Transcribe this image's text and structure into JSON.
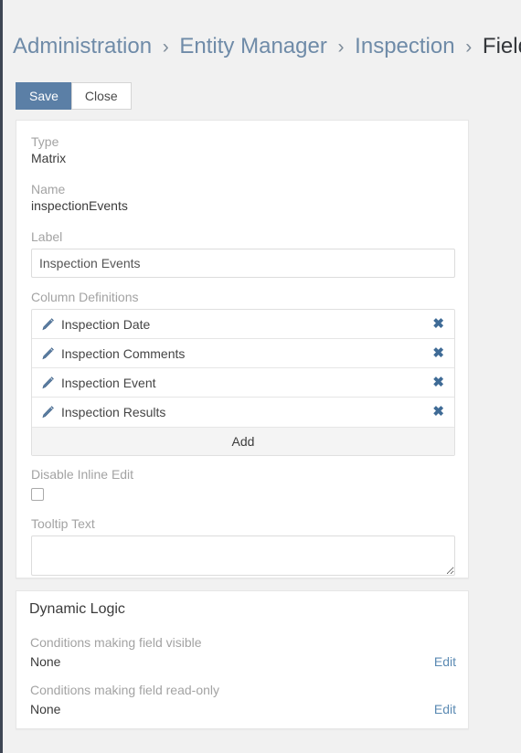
{
  "breadcrumb": {
    "separator": "›",
    "items": [
      {
        "label": "Administration",
        "current": false
      },
      {
        "label": "Entity Manager",
        "current": false
      },
      {
        "label": "Inspection",
        "current": false
      },
      {
        "label": "Fields",
        "current": true
      }
    ]
  },
  "toolbar": {
    "save_label": "Save",
    "close_label": "Close"
  },
  "field_panel": {
    "type": {
      "label": "Type",
      "value": "Matrix"
    },
    "name": {
      "label": "Name",
      "value": "inspectionEvents"
    },
    "label_field": {
      "label": "Label",
      "value": "Inspection Events",
      "placeholder": ""
    },
    "column_definitions": {
      "label": "Column Definitions",
      "add_label": "Add",
      "remove_icon": "✖",
      "items": [
        {
          "name": "Inspection Date"
        },
        {
          "name": "Inspection Comments"
        },
        {
          "name": "Inspection Event"
        },
        {
          "name": "Inspection Results"
        }
      ]
    },
    "disable_inline_edit": {
      "label": "Disable Inline Edit",
      "checked": false
    },
    "tooltip_text": {
      "label": "Tooltip Text",
      "value": "",
      "placeholder": ""
    }
  },
  "dynamic_logic": {
    "title": "Dynamic Logic",
    "rows": [
      {
        "label": "Conditions making field visible",
        "value": "None",
        "edit_label": "Edit"
      },
      {
        "label": "Conditions making field read-only",
        "value": "None",
        "edit_label": "Edit"
      }
    ]
  },
  "colors": {
    "page_background": "#f1f1f1",
    "sidebar_edge": "#3e4654",
    "primary_button": "#5b7fa6",
    "link": "#6f8ba8",
    "icon_blue": "#3f6b96",
    "muted_label": "#a3a3a3"
  }
}
